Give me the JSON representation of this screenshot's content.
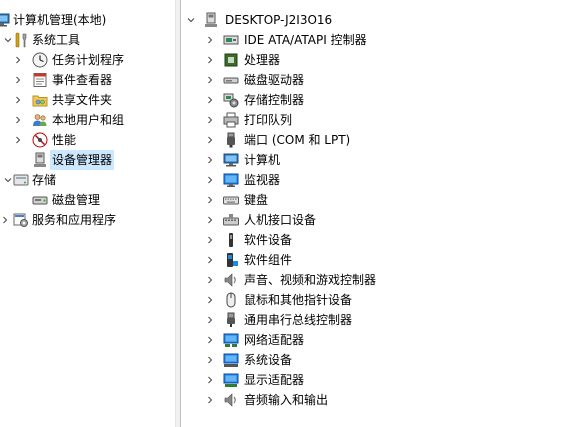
{
  "left_tree": {
    "root": {
      "label": "计算机管理(本地)",
      "icon": "computer-management-icon"
    },
    "groups": [
      {
        "label": "系统工具",
        "icon": "tools-icon",
        "expanded": true,
        "children": [
          {
            "label": "任务计划程序",
            "icon": "clock-icon"
          },
          {
            "label": "事件查看器",
            "icon": "event-viewer-icon"
          },
          {
            "label": "共享文件夹",
            "icon": "shared-folder-icon"
          },
          {
            "label": "本地用户和组",
            "icon": "users-icon"
          },
          {
            "label": "性能",
            "icon": "performance-icon"
          },
          {
            "label": "设备管理器",
            "icon": "device-manager-icon",
            "selected": true
          }
        ]
      },
      {
        "label": "存储",
        "icon": "storage-icon",
        "expanded": true,
        "children": [
          {
            "label": "磁盘管理",
            "icon": "disk-management-icon"
          }
        ]
      },
      {
        "label": "服务和应用程序",
        "icon": "services-icon",
        "expanded": false,
        "children": []
      }
    ]
  },
  "device_tree": {
    "computer_name": "DESKTOP-J2I3O16",
    "categories": [
      {
        "label": "IDE ATA/ATAPI 控制器",
        "icon": "ide-controller-icon"
      },
      {
        "label": "处理器",
        "icon": "processor-icon"
      },
      {
        "label": "磁盘驱动器",
        "icon": "disk-drive-icon"
      },
      {
        "label": "存储控制器",
        "icon": "storage-controller-icon"
      },
      {
        "label": "打印队列",
        "icon": "printer-icon"
      },
      {
        "label": "端口 (COM 和 LPT)",
        "icon": "port-icon"
      },
      {
        "label": "计算机",
        "icon": "computer-icon"
      },
      {
        "label": "监视器",
        "icon": "monitor-icon"
      },
      {
        "label": "键盘",
        "icon": "keyboard-icon"
      },
      {
        "label": "人机接口设备",
        "icon": "hid-icon"
      },
      {
        "label": "软件设备",
        "icon": "software-device-icon"
      },
      {
        "label": "软件组件",
        "icon": "software-component-icon"
      },
      {
        "label": "声音、视频和游戏控制器",
        "icon": "sound-icon"
      },
      {
        "label": "鼠标和其他指针设备",
        "icon": "mouse-icon"
      },
      {
        "label": "通用串行总线控制器",
        "icon": "usb-icon"
      },
      {
        "label": "网络适配器",
        "icon": "network-adapter-icon"
      },
      {
        "label": "系统设备",
        "icon": "system-device-icon"
      },
      {
        "label": "显示适配器",
        "icon": "display-adapter-icon"
      },
      {
        "label": "音频输入和输出",
        "icon": "audio-io-icon"
      }
    ]
  }
}
